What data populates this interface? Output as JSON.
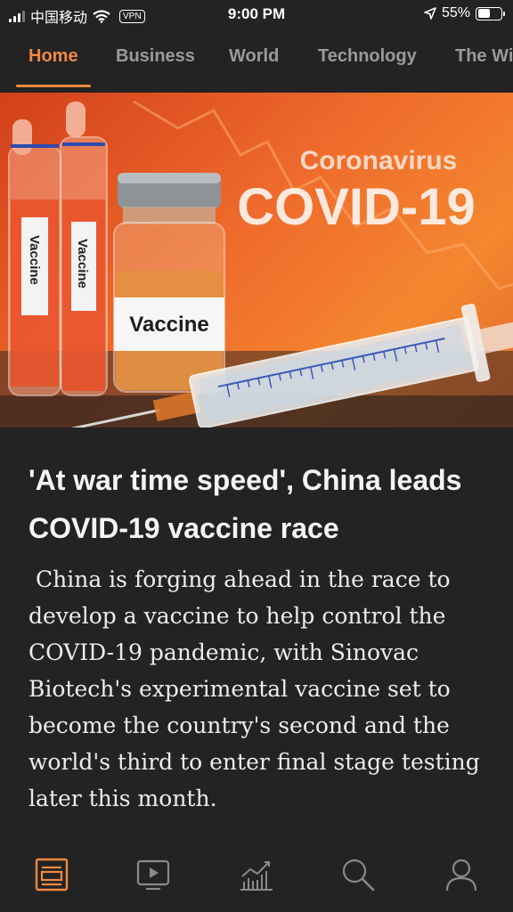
{
  "status_bar": {
    "carrier": "中国移动",
    "vpn": "VPN",
    "time": "9:00 PM",
    "battery": "55%",
    "battery_level": 0.55
  },
  "tabs": [
    {
      "label": "Home",
      "active": true
    },
    {
      "label": "Business",
      "active": false
    },
    {
      "label": "World",
      "active": false
    },
    {
      "label": "Technology",
      "active": false
    },
    {
      "label": "The Wi",
      "active": false
    }
  ],
  "hero": {
    "overlay_title": "Coronavirus",
    "overlay_subtitle": "COVID-19",
    "ampoule_label": "Vaccine",
    "vial_label": "Vaccine"
  },
  "article": {
    "headline": "'At war time speed', China leads COVID-19 vaccine race",
    "summary": "China is forging ahead in the race to develop a vaccine to help control the COVID-19 pandemic, with Sinovac Biotech's experimental vaccine set to become the country's second and the world's third to enter final stage testing later this month."
  },
  "bottom_nav": [
    {
      "icon": "news-icon",
      "active": true
    },
    {
      "icon": "video-icon",
      "active": false
    },
    {
      "icon": "markets-icon",
      "active": false
    },
    {
      "icon": "search-icon",
      "active": false
    },
    {
      "icon": "profile-icon",
      "active": false
    }
  ],
  "colors": {
    "accent": "#f08a42",
    "background": "#232323",
    "inactive": "#9a9a9a"
  }
}
